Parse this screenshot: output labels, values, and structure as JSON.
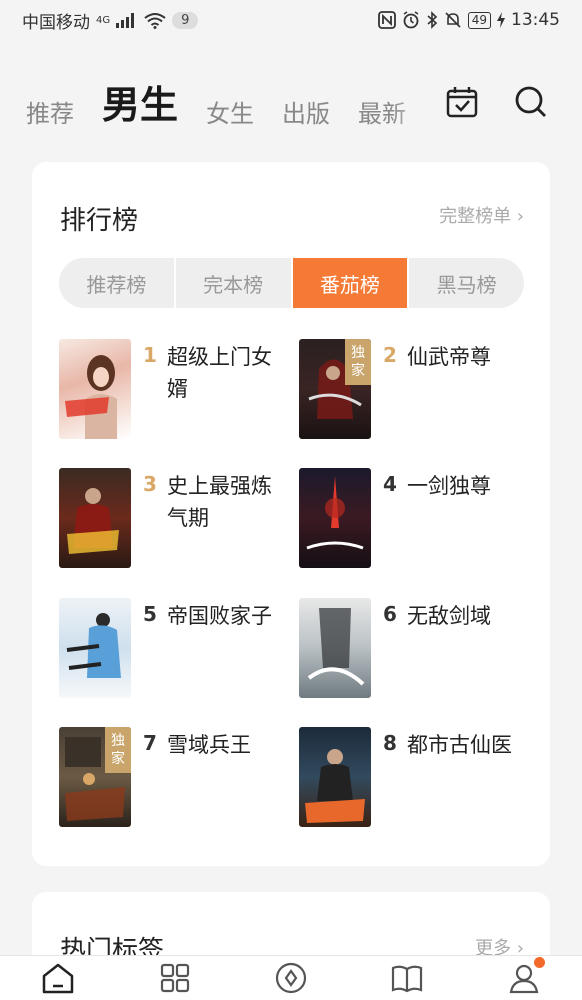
{
  "status": {
    "carrier": "中国移动",
    "signal": "4G",
    "notif_count": "9",
    "battery": "49",
    "time": "13:45"
  },
  "nav": {
    "tabs": [
      {
        "label": "推荐"
      },
      {
        "label": "男生"
      },
      {
        "label": "女生"
      },
      {
        "label": "出版"
      },
      {
        "label": "最新"
      }
    ],
    "icons": {
      "calendar": "calendar-check-icon",
      "search": "search-icon"
    }
  },
  "ranking": {
    "title": "排行榜",
    "full_list": "完整榜单 ›",
    "segments": [
      "推荐榜",
      "完本榜",
      "番茄榜",
      "黑马榜"
    ],
    "books": [
      {
        "rank": "1",
        "name": "超级上门女婿",
        "badge": ""
      },
      {
        "rank": "2",
        "name": "仙武帝尊",
        "badge": "独家"
      },
      {
        "rank": "3",
        "name": "史上最强炼气期",
        "badge": ""
      },
      {
        "rank": "4",
        "name": "一剑独尊",
        "badge": ""
      },
      {
        "rank": "5",
        "name": "帝国败家子",
        "badge": ""
      },
      {
        "rank": "6",
        "name": "无敌剑域",
        "badge": ""
      },
      {
        "rank": "7",
        "name": "雪域兵王",
        "badge": "独家"
      },
      {
        "rank": "8",
        "name": "都市古仙医",
        "badge": ""
      }
    ]
  },
  "hot_tags": {
    "title": "热门标签",
    "more": "更多 ›"
  },
  "bottom_bar": [
    "home-icon",
    "category-grid-icon",
    "discover-icon",
    "bookshelf-icon",
    "profile-icon"
  ],
  "colors": {
    "accent": "#f47a35",
    "rank_top": "#d9a867"
  }
}
